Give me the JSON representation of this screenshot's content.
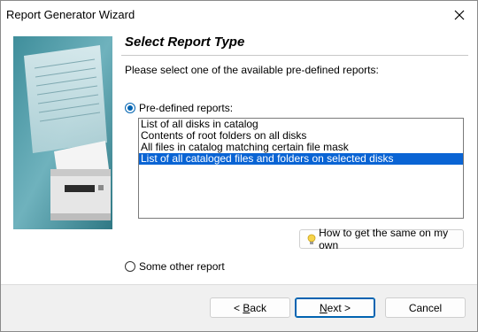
{
  "window": {
    "title": "Report Generator Wizard"
  },
  "page": {
    "heading": "Select Report Type",
    "description": "Please select one of the available pre-defined reports:"
  },
  "options": {
    "predefined_label": "Pre-defined reports:",
    "predefined_checked": true,
    "other_label": "Some other report",
    "other_checked": false
  },
  "reports": {
    "items": [
      "List of all disks in catalog",
      "Contents of root folders on all disks",
      "All files in catalog matching certain file mask",
      "List of all cataloged files and folders on selected disks"
    ],
    "selected_index": 3
  },
  "help_button": {
    "label": "How to get the same on my own"
  },
  "footer": {
    "back_mnemonic": "B",
    "back_rest": "ack",
    "back_prefix": "< ",
    "next_mnemonic": "N",
    "next_rest": "ext >",
    "cancel_label": "Cancel"
  },
  "colors": {
    "selection": "#0a64d4",
    "accent": "#0063b1"
  },
  "icons": {
    "close": "close-icon",
    "bulb": "lightbulb-icon"
  }
}
